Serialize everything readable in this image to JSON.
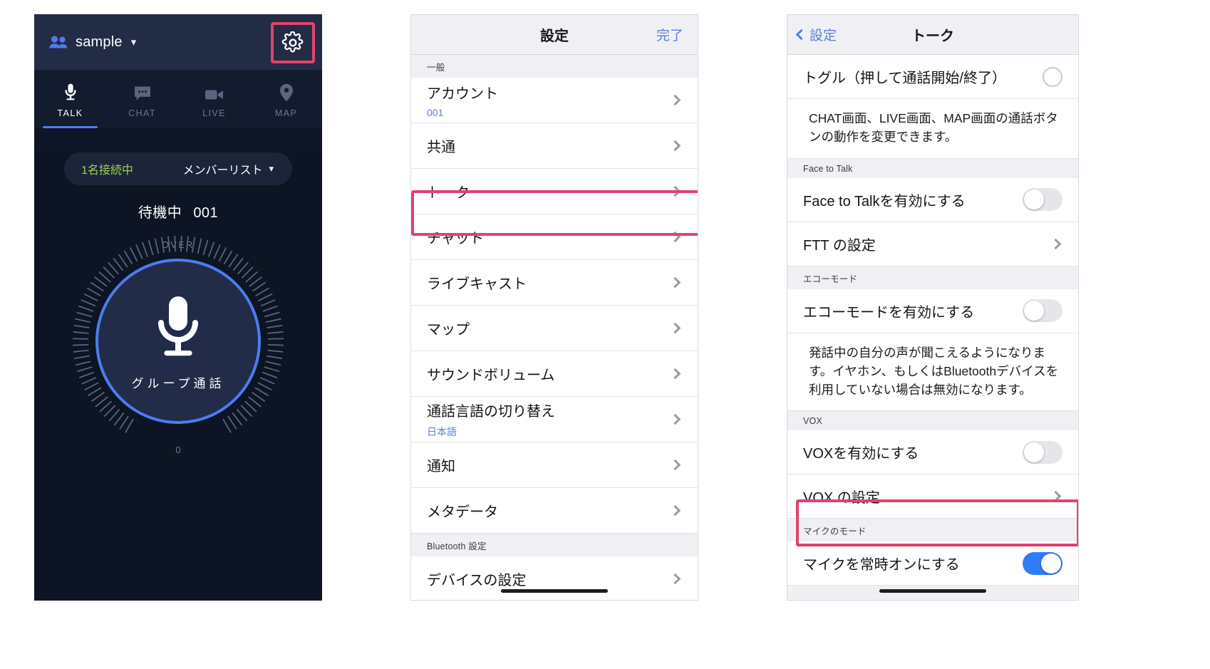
{
  "talk_screen": {
    "topbar": {
      "group_name": "sample",
      "chevron": "▾",
      "people_icon": "people-icon",
      "gear_icon": "gear-icon",
      "highlight_color": "#e0436d"
    },
    "tabs": [
      {
        "label": "TALK",
        "icon": "microphone-icon",
        "active": true
      },
      {
        "label": "CHAT",
        "icon": "chat-bubble-icon",
        "active": false
      },
      {
        "label": "LIVE",
        "icon": "video-camera-icon",
        "active": false
      },
      {
        "label": "MAP",
        "icon": "map-pin-icon",
        "active": false
      }
    ],
    "member_bar": {
      "count_text": "1名接続中",
      "list_label": "メンバーリスト",
      "chevron": "▾",
      "count_color": "#9bd157"
    },
    "status": {
      "state": "待機中",
      "id": "001"
    },
    "dial": {
      "over_label": "OVER",
      "zero_label": "0",
      "button_label": "グループ通話",
      "mic_icon": "microphone-icon",
      "ring_color": "#4d7cf0"
    }
  },
  "settings_screen": {
    "nav": {
      "title": "設定",
      "done_label": "完了"
    },
    "sections": [
      {
        "header": "一般",
        "rows": [
          {
            "label": "アカウント",
            "sub": "001",
            "chevron": true
          },
          {
            "label": "共通",
            "sub": "",
            "chevron": true
          },
          {
            "label": "トーク",
            "sub": "",
            "chevron": true,
            "highlighted": true
          },
          {
            "label": "チャット",
            "sub": "",
            "chevron": true
          },
          {
            "label": "ライブキャスト",
            "sub": "",
            "chevron": true
          },
          {
            "label": "マップ",
            "sub": "",
            "chevron": true
          },
          {
            "label": "サウンドボリューム",
            "sub": "",
            "chevron": true
          },
          {
            "label": "通話言語の切り替え",
            "sub": "日本語",
            "chevron": true
          },
          {
            "label": "通知",
            "sub": "",
            "chevron": true
          },
          {
            "label": "メタデータ",
            "sub": "",
            "chevron": true
          }
        ]
      },
      {
        "header": "Bluetooth 設定",
        "rows": [
          {
            "label": "デバイスの設定",
            "sub": "",
            "chevron": true
          }
        ]
      }
    ]
  },
  "talk_settings_screen": {
    "nav": {
      "back_label": "設定",
      "title": "トーク"
    },
    "items": [
      {
        "kind": "row-radio",
        "label": "トグル（押して通話開始/終了）",
        "selected": false
      },
      {
        "kind": "desc",
        "text": "CHAT画面、LIVE画面、MAP画面の通話ボタンの動作を変更できます。"
      },
      {
        "kind": "section",
        "header": "Face to Talk"
      },
      {
        "kind": "row-toggle",
        "label": "Face to Talkを有効にする",
        "on": false
      },
      {
        "kind": "row-chevron",
        "label": "FTT の設定"
      },
      {
        "kind": "section",
        "header": "エコーモード"
      },
      {
        "kind": "row-toggle",
        "label": "エコーモードを有効にする",
        "on": false
      },
      {
        "kind": "desc",
        "text": "発話中の自分の声が聞こえるようになります。イヤホン、もしくはBluetoothデバイスを利用していない場合は無効になります。"
      },
      {
        "kind": "section",
        "header": "VOX"
      },
      {
        "kind": "row-toggle",
        "label": "VOXを有効にする",
        "on": false
      },
      {
        "kind": "row-chevron",
        "label": "VOX の設定"
      },
      {
        "kind": "section",
        "header": "マイクのモード"
      },
      {
        "kind": "row-toggle",
        "label": "マイクを常時オンにする",
        "on": true,
        "highlighted": true
      }
    ]
  },
  "colors": {
    "accent_blue": "#4d7cf0",
    "ios_blue": "#5b7fd4",
    "toggle_on": "#2f7df6",
    "highlight_pink": "#e0436d",
    "green": "#9bd157",
    "dark_bg": "#0d1423",
    "dark_topbar": "#232c45"
  }
}
